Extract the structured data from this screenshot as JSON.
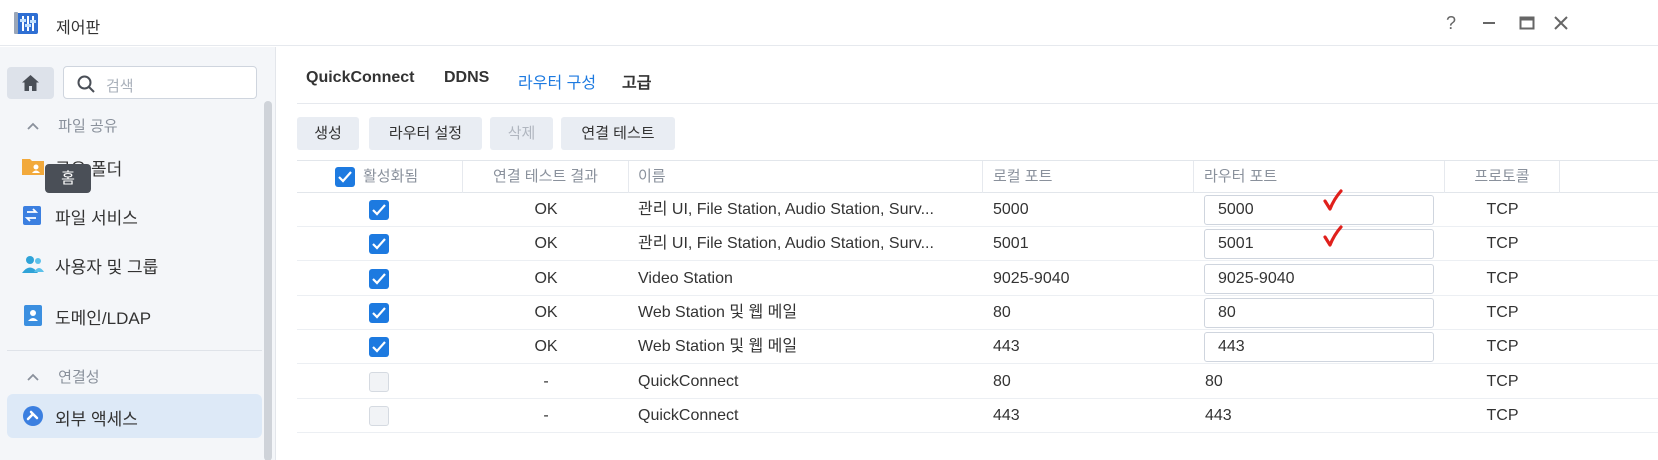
{
  "window": {
    "title": "제어판",
    "buttons": {
      "help": "?",
      "minimize": "—",
      "maximize": "▭",
      "close": "✕"
    }
  },
  "sidebar": {
    "search_placeholder": "검색",
    "tooltip": "홈",
    "section_file_sharing": "파일 공유",
    "items": [
      {
        "label": "공유 폴더",
        "icon": "shared-folder-icon"
      },
      {
        "label": "파일 서비스",
        "icon": "file-services-icon"
      },
      {
        "label": "사용자 및 그룹",
        "icon": "user-group-icon"
      },
      {
        "label": "도메인/LDAP",
        "icon": "domain-ldap-icon"
      }
    ],
    "section_connectivity": "연결성",
    "active_item": {
      "label": "외부 액세스",
      "icon": "external-access-icon"
    }
  },
  "tabs": [
    {
      "label": "QuickConnect"
    },
    {
      "label": "DDNS"
    },
    {
      "label": "라우터 구성",
      "active": true
    },
    {
      "label": "고급"
    }
  ],
  "toolbar": {
    "create": "생성",
    "router_settings": "라우터 설정",
    "delete": "삭제",
    "test_connection": "연결 테스트"
  },
  "table": {
    "headers": {
      "enabled": "활성화됨",
      "test_result": "연결 테스트 결과",
      "name": "이름",
      "local_port": "로컬 포트",
      "router_port": "라우터 포트",
      "protocol": "프로토콜"
    },
    "rows": [
      {
        "enabled": true,
        "result": "OK",
        "name": "관리 UI, File Station, Audio Station, Surv...",
        "local": "5000",
        "router": "5000",
        "editable": true,
        "protocol": "TCP"
      },
      {
        "enabled": true,
        "result": "OK",
        "name": "관리 UI, File Station, Audio Station, Surv...",
        "local": "5001",
        "router": "5001",
        "editable": true,
        "protocol": "TCP"
      },
      {
        "enabled": true,
        "result": "OK",
        "name": "Video Station",
        "local": "9025-9040",
        "router": "9025-9040",
        "editable": true,
        "protocol": "TCP"
      },
      {
        "enabled": true,
        "result": "OK",
        "name": "Web Station 및 웹 메일",
        "local": "80",
        "router": "80",
        "editable": true,
        "protocol": "TCP"
      },
      {
        "enabled": true,
        "result": "OK",
        "name": "Web Station 및 웹 메일",
        "local": "443",
        "router": "443",
        "editable": true,
        "protocol": "TCP"
      },
      {
        "enabled": false,
        "result": "-",
        "name": "QuickConnect",
        "local": "80",
        "router": "80",
        "editable": false,
        "protocol": "TCP"
      },
      {
        "enabled": false,
        "result": "-",
        "name": "QuickConnect",
        "local": "443",
        "router": "443",
        "editable": false,
        "protocol": "TCP"
      }
    ]
  },
  "colors": {
    "accent": "#1d7ae0",
    "annotation": "#e0201c"
  }
}
